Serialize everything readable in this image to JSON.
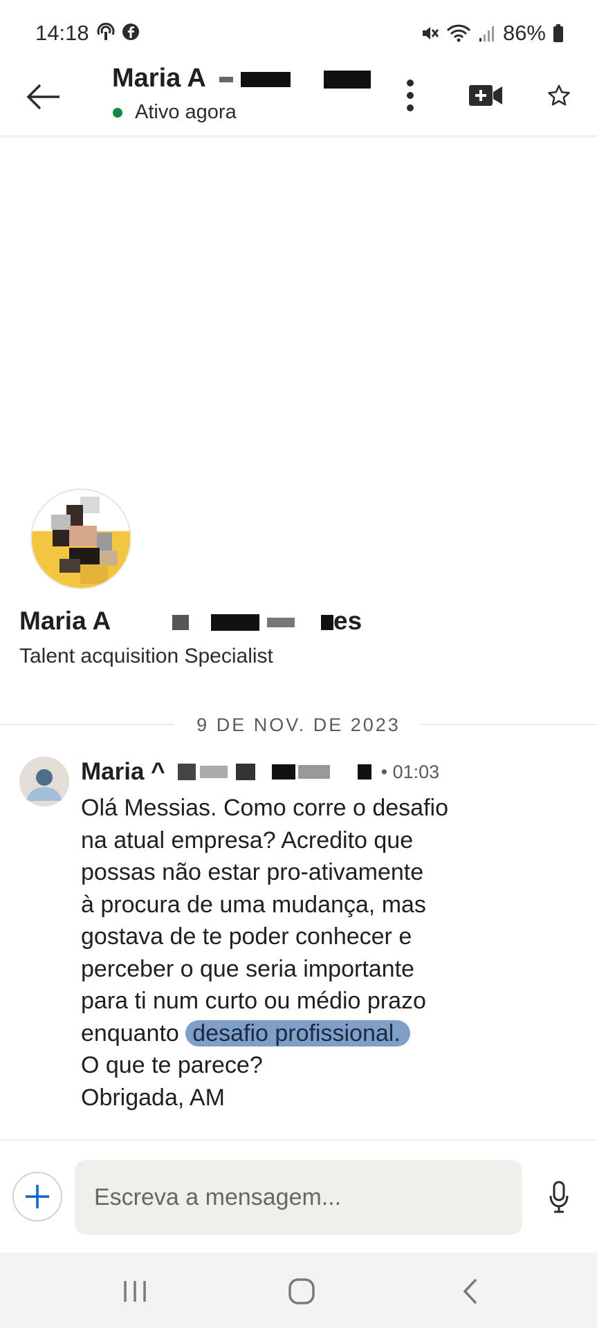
{
  "status_bar": {
    "time": "14:18",
    "battery": "86%"
  },
  "header": {
    "name": "Maria A",
    "presence": "Ativo agora",
    "presence_color": "#0e8a45"
  },
  "profile": {
    "name": "Maria A",
    "name_suffix": "es",
    "headline": "Talent acquisition Specialist"
  },
  "conversation": {
    "date_divider": "9 DE NOV. DE 2023",
    "messages": [
      {
        "sender": "Maria ^",
        "time": "• 01:03",
        "lines": [
          "Olá Messias. Como corre o desafio",
          "na atual empresa? Acredito que",
          "possas não estar pro-ativamente",
          "à procura de uma mudança, mas",
          "gostava de te poder conhecer e",
          "perceber o que seria importante",
          "para ti num curto ou médio prazo",
          "enquanto",
          "O que te parece?",
          "Obrigada, AM"
        ],
        "highlighted": "desafio profissional.",
        "highlight_color": "#4a76b0"
      }
    ]
  },
  "composer": {
    "placeholder": "Escreva a mensagem..."
  },
  "icons": {
    "back": "arrow-left-icon",
    "more": "more-vertical-icon",
    "video": "video-plus-icon",
    "star": "star-outline-icon",
    "attach": "plus-icon",
    "mic": "microphone-icon"
  }
}
